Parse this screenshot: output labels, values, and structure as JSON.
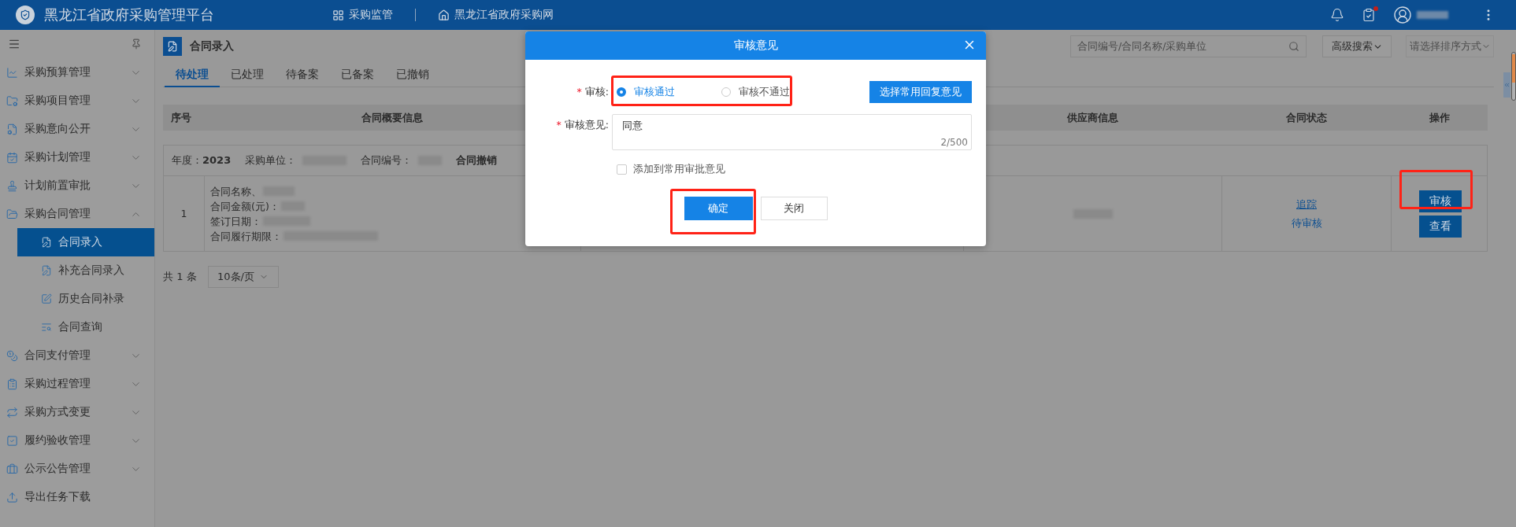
{
  "top_bar": {
    "title": "黑龙江省政府采购管理平台",
    "nav": [
      {
        "label": "采购监管"
      },
      {
        "label": "黑龙江省政府采购网"
      }
    ],
    "tasks_alert": true
  },
  "sidebar": {
    "items": [
      {
        "label": "采购预算管理",
        "kind": "group",
        "expanded": false
      },
      {
        "label": "采购项目管理",
        "kind": "group",
        "expanded": false
      },
      {
        "label": "采购意向公开",
        "kind": "group",
        "expanded": false
      },
      {
        "label": "采购计划管理",
        "kind": "group",
        "expanded": false
      },
      {
        "label": "计划前置审批",
        "kind": "group",
        "expanded": false
      },
      {
        "label": "采购合同管理",
        "kind": "group",
        "expanded": true,
        "children": [
          {
            "label": "合同录入",
            "selected": true
          },
          {
            "label": "补充合同录入",
            "selected": false
          },
          {
            "label": "历史合同补录",
            "selected": false
          },
          {
            "label": "合同查询",
            "selected": false
          }
        ]
      },
      {
        "label": "合同支付管理",
        "kind": "group",
        "expanded": false
      },
      {
        "label": "采购过程管理",
        "kind": "group",
        "expanded": false
      },
      {
        "label": "采购方式变更",
        "kind": "group",
        "expanded": false
      },
      {
        "label": "履约验收管理",
        "kind": "group",
        "expanded": false
      },
      {
        "label": "公示公告管理",
        "kind": "group",
        "expanded": false
      },
      {
        "label": "导出任务下载",
        "kind": "link"
      }
    ]
  },
  "page": {
    "title": "合同录入",
    "tabs": [
      {
        "label": "待处理",
        "selected": true
      },
      {
        "label": "已处理",
        "selected": false
      },
      {
        "label": "待备案",
        "selected": false
      },
      {
        "label": "已备案",
        "selected": false
      },
      {
        "label": "已撤销",
        "selected": false
      }
    ],
    "search": {
      "placeholder": "合同编号/合同名称/采购单位"
    },
    "advanced_search": "高级搜索",
    "sort_select": {
      "placeholder": "请选择排序方式"
    }
  },
  "table": {
    "columns": [
      {
        "label": "序号"
      },
      {
        "label": "合同概要信息"
      },
      {
        "label": "供应商信息"
      },
      {
        "label": "合同状态"
      },
      {
        "label": "操作"
      }
    ],
    "group": {
      "year_label": "年度：",
      "year": "2023",
      "unit_label": "采购单位：",
      "number_label": "合同编号：",
      "action": "合同撤销"
    },
    "rows": [
      {
        "index": "1",
        "summary": [
          "合同名称、",
          "合同金额(元)：",
          "签订日期：",
          "合同履行期限："
        ],
        "status_link": "追踪",
        "status": "待审核",
        "actions": [
          "审核",
          "查看"
        ]
      }
    ]
  },
  "pagination": {
    "total": "共 1 条",
    "page_size": "10条/页"
  },
  "dialog": {
    "title": "审核意见",
    "review_label": {
      "mark": "*",
      "text": "审核:"
    },
    "options": [
      {
        "label": "审核通过",
        "selected": true
      },
      {
        "label": "审核不通过",
        "selected": false
      }
    ],
    "preset_button": "选择常用回复意见",
    "comment_label": {
      "mark": "*",
      "text": "审核意见:"
    },
    "comment": "同意",
    "counter": "2/500",
    "save_option": {
      "label": "添加到常用审批意见",
      "checked": false
    },
    "buttons": [
      {
        "label": "确定",
        "kind": "primary"
      },
      {
        "label": "关闭",
        "kind": "default"
      }
    ]
  }
}
